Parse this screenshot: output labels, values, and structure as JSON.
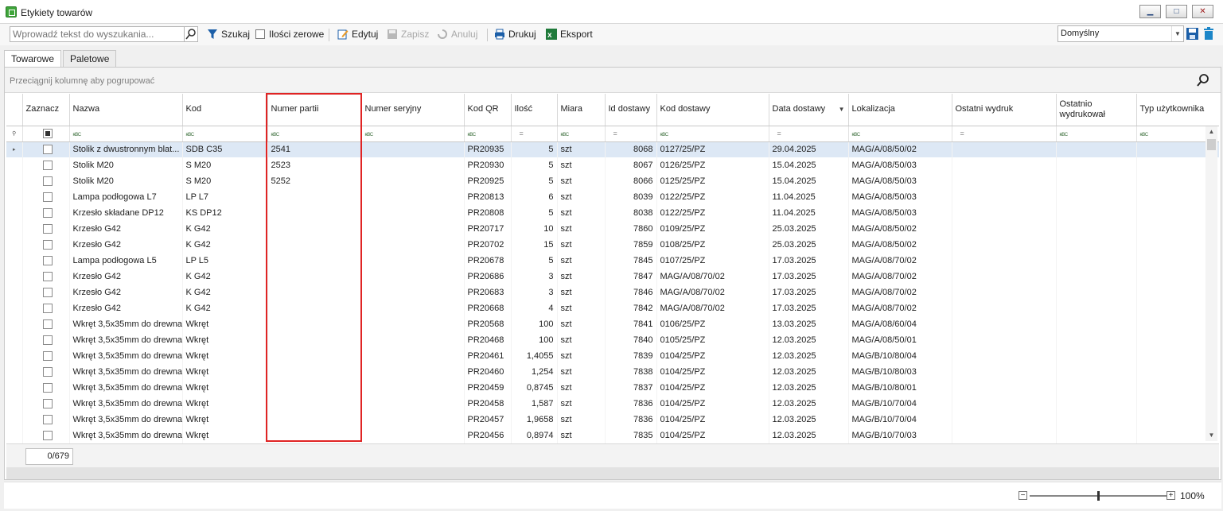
{
  "window": {
    "title": "Etykiety towarów",
    "icon": "basket-icon"
  },
  "toolbar": {
    "search_placeholder": "Wprowadź tekst do wyszukania...",
    "szukaj": "Szukaj",
    "ilosci_zerowe": "Ilości zerowe",
    "edytuj": "Edytuj",
    "zapisz": "Zapisz",
    "anuluj": "Anuluj",
    "drukuj": "Drukuj",
    "eksport": "Eksport",
    "layout": "Domyślny"
  },
  "tabs": [
    {
      "label": "Towarowe",
      "active": true
    },
    {
      "label": "Paletowe",
      "active": false
    }
  ],
  "group_panel_text": "Przeciągnij kolumnę aby pogrupować",
  "columns": [
    "Zaznacz",
    "Nazwa",
    "Kod",
    "Numer partii",
    "Numer seryjny",
    "Kod QR",
    "Ilość",
    "Miara",
    "Id dostawy",
    "Kod dostawy",
    "Data dostawy",
    "Lokalizacja",
    "Ostatni wydruk",
    "Ostatnio wydrukował",
    "Typ użytkownika"
  ],
  "filter_icons": [
    "",
    "abc",
    "abc",
    "abc",
    "abc",
    "abc",
    "eq",
    "abc",
    "eq",
    "abc",
    "eq",
    "abc",
    "eq",
    "abc",
    "abc"
  ],
  "rows": [
    {
      "nazwa": "Stolik z dwustronnym blat...",
      "kod": "SDB C35",
      "partia": "2541",
      "seryjny": "",
      "qr": "PR20935",
      "ilosc": "5",
      "miara": "szt",
      "id": "8068",
      "kod_dostawy": "0127/25/PZ",
      "data": "29.04.2025",
      "lokalizacja": "MAG/A/08/50/02",
      "selected": true
    },
    {
      "nazwa": "Stolik M20",
      "kod": "S M20",
      "partia": "2523",
      "seryjny": "",
      "qr": "PR20930",
      "ilosc": "5",
      "miara": "szt",
      "id": "8067",
      "kod_dostawy": "0126/25/PZ",
      "data": "15.04.2025",
      "lokalizacja": "MAG/A/08/50/03"
    },
    {
      "nazwa": "Stolik M20",
      "kod": "S M20",
      "partia": "5252",
      "seryjny": "",
      "qr": "PR20925",
      "ilosc": "5",
      "miara": "szt",
      "id": "8066",
      "kod_dostawy": "0125/25/PZ",
      "data": "15.04.2025",
      "lokalizacja": "MAG/A/08/50/03"
    },
    {
      "nazwa": "Lampa podłogowa L7",
      "kod": "LP L7",
      "partia": "",
      "seryjny": "",
      "qr": "PR20813",
      "ilosc": "6",
      "miara": "szt",
      "id": "8039",
      "kod_dostawy": "0122/25/PZ",
      "data": "11.04.2025",
      "lokalizacja": "MAG/A/08/50/03"
    },
    {
      "nazwa": "Krzesło składane DP12",
      "kod": "KS DP12",
      "partia": "",
      "seryjny": "",
      "qr": "PR20808",
      "ilosc": "5",
      "miara": "szt",
      "id": "8038",
      "kod_dostawy": "0122/25/PZ",
      "data": "11.04.2025",
      "lokalizacja": "MAG/A/08/50/03"
    },
    {
      "nazwa": "Krzesło G42",
      "kod": "K G42",
      "partia": "",
      "seryjny": "",
      "qr": "PR20717",
      "ilosc": "10",
      "miara": "szt",
      "id": "7860",
      "kod_dostawy": "0109/25/PZ",
      "data": "25.03.2025",
      "lokalizacja": "MAG/A/08/50/02"
    },
    {
      "nazwa": "Krzesło G42",
      "kod": "K G42",
      "partia": "",
      "seryjny": "",
      "qr": "PR20702",
      "ilosc": "15",
      "miara": "szt",
      "id": "7859",
      "kod_dostawy": "0108/25/PZ",
      "data": "25.03.2025",
      "lokalizacja": "MAG/A/08/50/02"
    },
    {
      "nazwa": "Lampa podłogowa L5",
      "kod": "LP L5",
      "partia": "",
      "seryjny": "",
      "qr": "PR20678",
      "ilosc": "5",
      "miara": "szt",
      "id": "7845",
      "kod_dostawy": "0107/25/PZ",
      "data": "17.03.2025",
      "lokalizacja": "MAG/A/08/70/02"
    },
    {
      "nazwa": "Krzesło G42",
      "kod": "K G42",
      "partia": "",
      "seryjny": "",
      "qr": "PR20686",
      "ilosc": "3",
      "miara": "szt",
      "id": "7847",
      "kod_dostawy": "MAG/A/08/70/02",
      "data": "17.03.2025",
      "lokalizacja": "MAG/A/08/70/02"
    },
    {
      "nazwa": "Krzesło G42",
      "kod": "K G42",
      "partia": "",
      "seryjny": "",
      "qr": "PR20683",
      "ilosc": "3",
      "miara": "szt",
      "id": "7846",
      "kod_dostawy": "MAG/A/08/70/02",
      "data": "17.03.2025",
      "lokalizacja": "MAG/A/08/70/02"
    },
    {
      "nazwa": "Krzesło G42",
      "kod": "K G42",
      "partia": "",
      "seryjny": "",
      "qr": "PR20668",
      "ilosc": "4",
      "miara": "szt",
      "id": "7842",
      "kod_dostawy": "MAG/A/08/70/02",
      "data": "17.03.2025",
      "lokalizacja": "MAG/A/08/70/02"
    },
    {
      "nazwa": "Wkręt 3,5x35mm do drewna",
      "kod": "Wkręt",
      "partia": "",
      "seryjny": "",
      "qr": "PR20568",
      "ilosc": "100",
      "miara": "szt",
      "id": "7841",
      "kod_dostawy": "0106/25/PZ",
      "data": "13.03.2025",
      "lokalizacja": "MAG/A/08/60/04"
    },
    {
      "nazwa": "Wkręt 3,5x35mm do drewna",
      "kod": "Wkręt",
      "partia": "",
      "seryjny": "",
      "qr": "PR20468",
      "ilosc": "100",
      "miara": "szt",
      "id": "7840",
      "kod_dostawy": "0105/25/PZ",
      "data": "12.03.2025",
      "lokalizacja": "MAG/A/08/50/01"
    },
    {
      "nazwa": "Wkręt 3,5x35mm do drewna",
      "kod": "Wkręt",
      "partia": "",
      "seryjny": "",
      "qr": "PR20461",
      "ilosc": "1,4055",
      "miara": "szt",
      "id": "7839",
      "kod_dostawy": "0104/25/PZ",
      "data": "12.03.2025",
      "lokalizacja": "MAG/B/10/80/04"
    },
    {
      "nazwa": "Wkręt 3,5x35mm do drewna",
      "kod": "Wkręt",
      "partia": "",
      "seryjny": "",
      "qr": "PR20460",
      "ilosc": "1,254",
      "miara": "szt",
      "id": "7838",
      "kod_dostawy": "0104/25/PZ",
      "data": "12.03.2025",
      "lokalizacja": "MAG/B/10/80/03"
    },
    {
      "nazwa": "Wkręt 3,5x35mm do drewna",
      "kod": "Wkręt",
      "partia": "",
      "seryjny": "",
      "qr": "PR20459",
      "ilosc": "0,8745",
      "miara": "szt",
      "id": "7837",
      "kod_dostawy": "0104/25/PZ",
      "data": "12.03.2025",
      "lokalizacja": "MAG/B/10/80/01"
    },
    {
      "nazwa": "Wkręt 3,5x35mm do drewna",
      "kod": "Wkręt",
      "partia": "",
      "seryjny": "",
      "qr": "PR20458",
      "ilosc": "1,587",
      "miara": "szt",
      "id": "7836",
      "kod_dostawy": "0104/25/PZ",
      "data": "12.03.2025",
      "lokalizacja": "MAG/B/10/70/04"
    },
    {
      "nazwa": "Wkręt 3,5x35mm do drewna",
      "kod": "Wkręt",
      "partia": "",
      "seryjny": "",
      "qr": "PR20457",
      "ilosc": "1,9658",
      "miara": "szt",
      "id": "7836",
      "kod_dostawy": "0104/25/PZ",
      "data": "12.03.2025",
      "lokalizacja": "MAG/B/10/70/04"
    },
    {
      "nazwa": "Wkręt 3,5x35mm do drewna",
      "kod": "Wkręt",
      "partia": "",
      "seryjny": "",
      "qr": "PR20456",
      "ilosc": "0,8974",
      "miara": "szt",
      "id": "7835",
      "kod_dostawy": "0104/25/PZ",
      "data": "12.03.2025",
      "lokalizacja": "MAG/B/10/70/03"
    }
  ],
  "footer": {
    "count": "0/679"
  },
  "zoom": {
    "label": "100%",
    "minus": "−",
    "plus": "+"
  },
  "colors": {
    "highlight": "#e02424",
    "selected_row": "#dde8f5"
  }
}
